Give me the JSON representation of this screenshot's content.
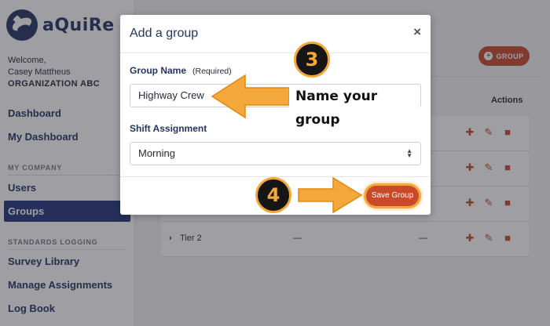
{
  "app": {
    "name": "aQuiRe"
  },
  "user": {
    "welcome": "Welcome,",
    "name": "Casey Mattheus",
    "organization": "ORGANIZATION ABC"
  },
  "nav": {
    "dashboard": "Dashboard",
    "my_dashboard": "My Dashboard",
    "section_company": "MY COMPANY",
    "users": "Users",
    "groups": "Groups",
    "section_logging": "STANDARDS LOGGING",
    "survey_library": "Survey Library",
    "manage_assignments": "Manage Assignments",
    "log_book": "Log Book"
  },
  "main": {
    "add_group_label": "GROUP",
    "actions_header": "Actions",
    "rows": [
      {
        "name": "",
        "col2": "",
        "col3": ""
      },
      {
        "name": "",
        "col2": "",
        "col3": ""
      },
      {
        "name": "",
        "col2": "",
        "col3": ""
      },
      {
        "name": "Tier 2",
        "col2": "—",
        "col3": "—"
      }
    ]
  },
  "modal": {
    "title": "Add a group",
    "close": "×",
    "group_name_label": "Group Name",
    "group_name_hint": "(Required)",
    "group_name_value": "Highway Crew",
    "shift_label": "Shift Assignment",
    "shift_value": "Morning",
    "save_label": "Save Group"
  },
  "annotations": {
    "step3": "3",
    "step3_text": "Name your group",
    "step4": "4",
    "accent_color": "#f4a73a"
  },
  "colors": {
    "brand_navy": "#24355f",
    "accent_red": "#c94a2a",
    "active_nav": "#26357a"
  }
}
